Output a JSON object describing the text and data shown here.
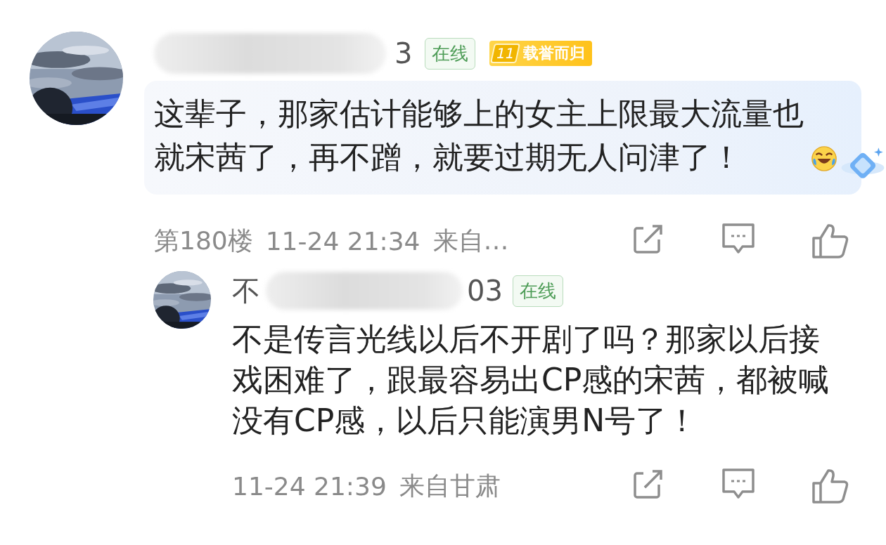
{
  "comment": {
    "author": {
      "name_end": "3",
      "name_blurred": true
    },
    "status": "在线",
    "level_badge": {
      "level": "11",
      "title": "载誉而归"
    },
    "text": "这辈子，那家估计能够上的女主上限最大流量也就宋茜了，再不蹭，就要过期无人问津了！",
    "floor": "第180楼",
    "time": "11-24 21:34",
    "location": "来自…"
  },
  "reply": {
    "author": {
      "name_start": "不",
      "name_end": "03",
      "name_blurred": true
    },
    "status": "在线",
    "text": "不是传言光线以后不开剧了吗？那家以后接戏困难了，跟最容易出CP感的宋茜，都被喊没有CP感，以后只能演男N号了！",
    "time": "11-24 21:39",
    "location": "来自甘肃"
  }
}
